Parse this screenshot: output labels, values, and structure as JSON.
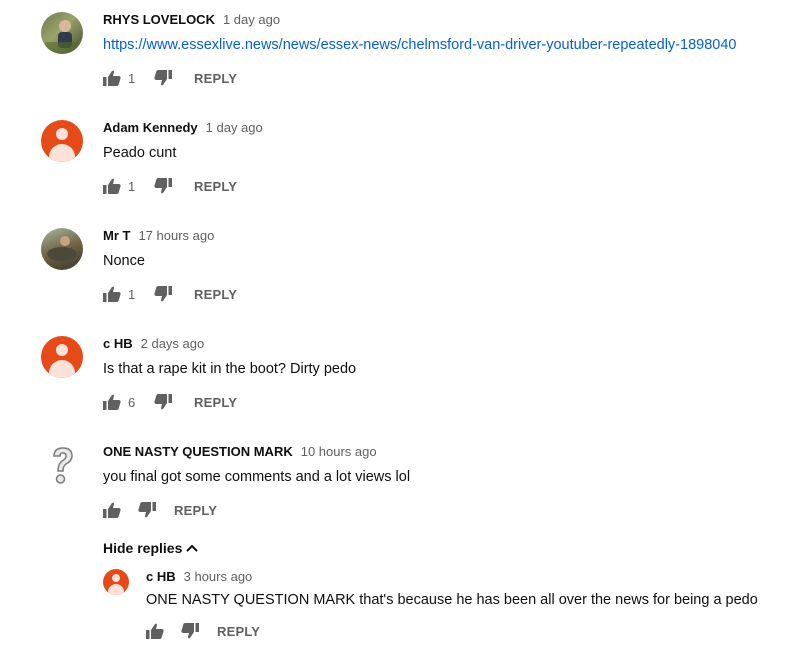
{
  "comments": [
    {
      "author": "RHYS LOVELOCK",
      "time": "1 day ago",
      "text": "https://www.essexlive.news/news/essex-news/chelmsford-van-driver-youtuber-repeatedly-1898040",
      "likes": "1",
      "reply_label": "REPLY",
      "avatar_icon": "photo-avatar"
    },
    {
      "author": "Adam Kennedy",
      "time": "1 day ago",
      "text": "Peado cunt",
      "likes": "1",
      "reply_label": "REPLY",
      "avatar_icon": "default-avatar"
    },
    {
      "author": "Mr T",
      "time": "17 hours ago",
      "text": "Nonce",
      "likes": "1",
      "reply_label": "REPLY",
      "avatar_icon": "photo-avatar"
    },
    {
      "author": "c HB",
      "time": "2 days ago",
      "text": "Is that a rape kit in the boot? Dirty pedo",
      "likes": "6",
      "reply_label": "REPLY",
      "avatar_icon": "default-avatar"
    },
    {
      "author": "ONE NASTY QUESTION MARK",
      "time": "10 hours ago",
      "text": "you final got some comments and a lot views lol",
      "likes": "",
      "reply_label": "REPLY",
      "avatar_icon": "question-mark-avatar"
    }
  ],
  "hide_replies_label": "Hide replies",
  "reply": {
    "author": "c HB",
    "time": "3 hours ago",
    "text": "ONE NASTY QUESTION MARK that's because he has been all over the news for being a pedo",
    "reply_label": "REPLY",
    "avatar_icon": "default-avatar"
  },
  "colors": {
    "link": "#065fd4",
    "avatar_orange": "#e64a19",
    "muted": "#606060"
  }
}
